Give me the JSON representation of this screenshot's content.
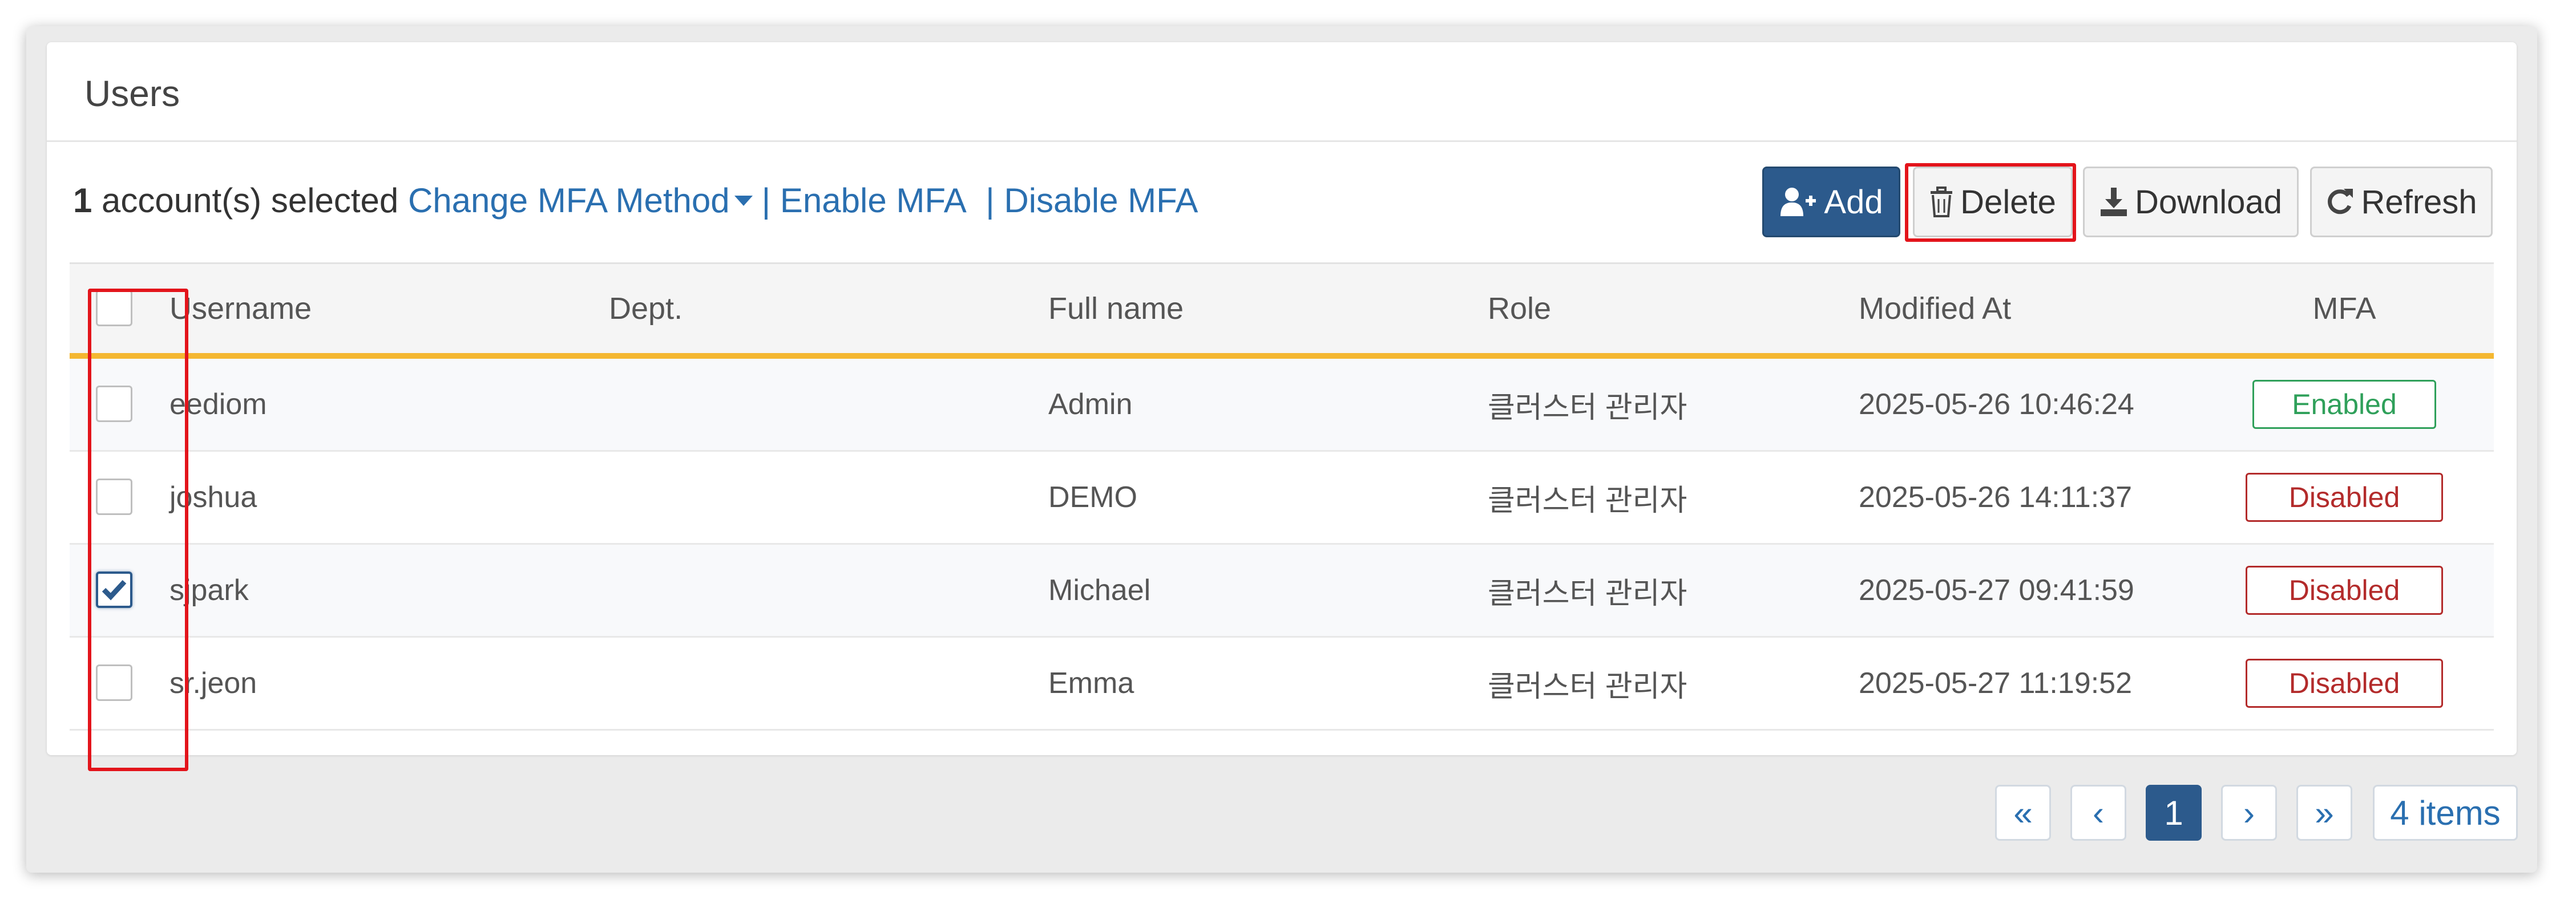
{
  "panel": {
    "title": "Users"
  },
  "selection": {
    "count": "1",
    "text": " account(s) selected ",
    "change_mfa": "Change MFA Method",
    "enable_mfa": "| Enable MFA",
    "disable_mfa": "| Disable MFA"
  },
  "toolbar": {
    "add_label": "Add",
    "delete_label": "Delete",
    "download_label": "Download",
    "refresh_label": "Refresh"
  },
  "table": {
    "columns": {
      "username": "Username",
      "dept": "Dept.",
      "full_name": "Full name",
      "role": "Role",
      "modified_at": "Modified At",
      "mfa": "MFA"
    },
    "rows": [
      {
        "username": "eediom",
        "dept": "",
        "full_name": "Admin",
        "role": "클러스터 관리자",
        "modified_at": "2025-05-26 10:46:24",
        "mfa": "Enabled",
        "checked": false
      },
      {
        "username": "joshua",
        "dept": "",
        "full_name": "DEMO",
        "role": "클러스터 관리자",
        "modified_at": "2025-05-26 14:11:37",
        "mfa": "Disabled",
        "checked": false
      },
      {
        "username": "sjpark",
        "dept": "",
        "full_name": "Michael",
        "role": "클러스터 관리자",
        "modified_at": "2025-05-27 09:41:59",
        "mfa": "Disabled",
        "checked": true
      },
      {
        "username": "sr.jeon",
        "dept": "",
        "full_name": "Emma",
        "role": "클러스터 관리자",
        "modified_at": "2025-05-27 11:19:52",
        "mfa": "Disabled",
        "checked": false
      }
    ]
  },
  "pagination": {
    "first": "«",
    "prev": "‹",
    "current": "1",
    "next": "›",
    "last": "»",
    "items": "4 items"
  },
  "colors": {
    "primary": "#2c5a8c",
    "link": "#2a6fb0",
    "header_underline": "#f4b731",
    "enabled": "#2fa05a",
    "disabled": "#b32b2b",
    "highlight": "#e3141b"
  }
}
